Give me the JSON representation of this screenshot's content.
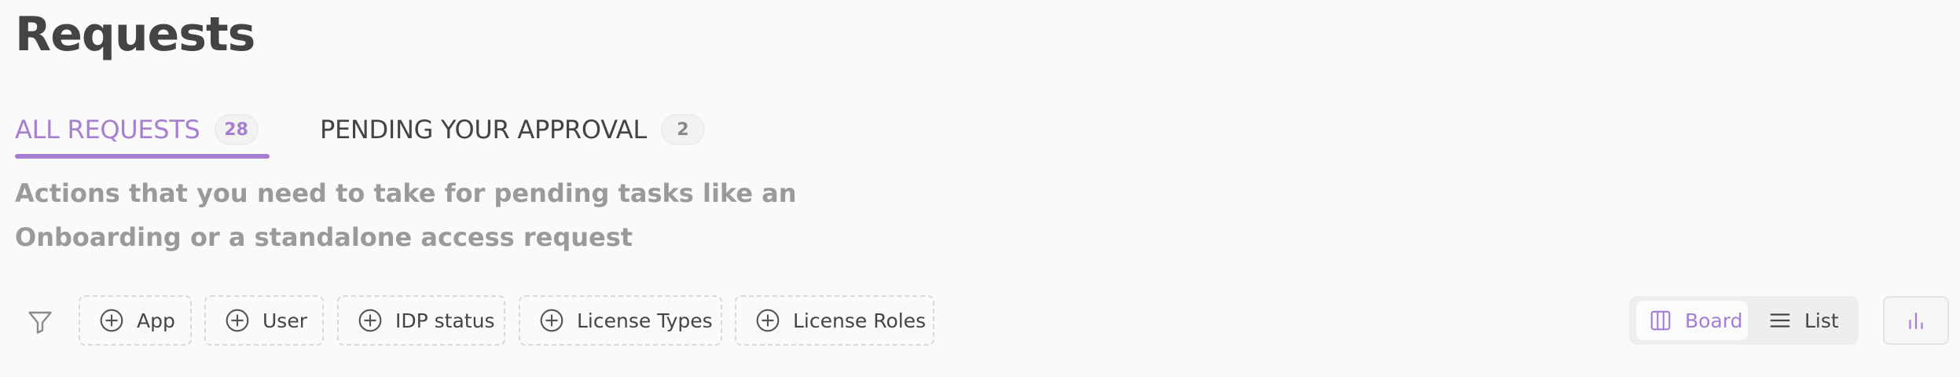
{
  "page": {
    "title": "Requests",
    "description": "Actions that you need to take for pending tasks like an Onboarding or a standalone access request"
  },
  "tabs": [
    {
      "label": "ALL REQUESTS",
      "count": "28",
      "active": true
    },
    {
      "label": "PENDING YOUR APPROVAL",
      "count": "2",
      "active": false
    }
  ],
  "filters": {
    "icon": "filter-icon",
    "chips": [
      {
        "label": "App",
        "icon": "plus-circle-icon"
      },
      {
        "label": "User",
        "icon": "plus-circle-icon"
      },
      {
        "label": "IDP status",
        "icon": "plus-circle-icon"
      },
      {
        "label": "License Types",
        "icon": "plus-circle-icon"
      },
      {
        "label": "License Roles",
        "icon": "plus-circle-icon"
      }
    ]
  },
  "view_toggle": {
    "selected": "Board",
    "options": [
      {
        "label": "Board",
        "icon": "columns-icon"
      },
      {
        "label": "List",
        "icon": "list-icon"
      }
    ]
  },
  "chart_button": {
    "icon": "bar-chart-icon"
  },
  "colors": {
    "accent": "#a67fd0",
    "text": "#444444",
    "muted_text": "#9a9a9a",
    "background": "#fafafa"
  }
}
